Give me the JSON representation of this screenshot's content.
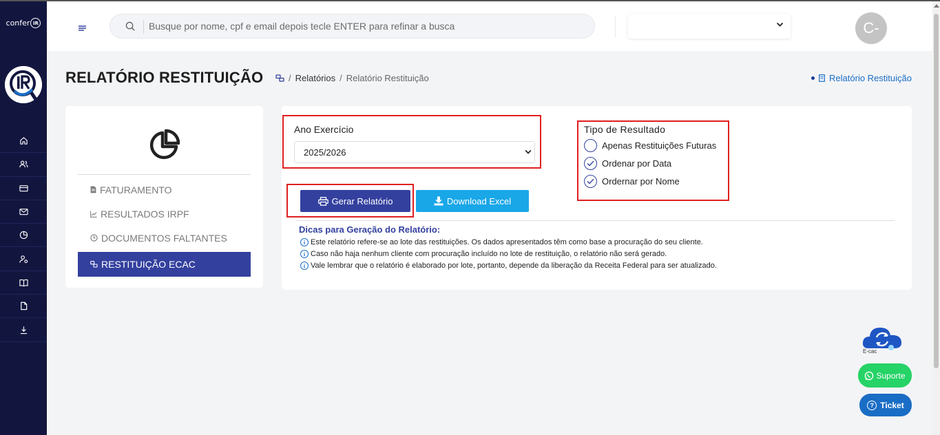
{
  "brand": {
    "logo_text": "confer",
    "logo_mark": "IR"
  },
  "header": {
    "search_placeholder": "Busque por nome, cpf e email depois tecle ENTER para refinar a busca",
    "avatar_initial": "C-"
  },
  "page": {
    "title": "RELATÓRIO RESTITUIÇÃO",
    "breadcrumb": {
      "parent": "Relatórios",
      "current": "Relatório Restituição",
      "separator": "/"
    },
    "top_right_link": "Relatório Restituição"
  },
  "left_menu": {
    "items": [
      {
        "label": "FATURAMENTO",
        "icon": "document-icon"
      },
      {
        "label": "RESULTADOS IRPF",
        "icon": "chart-line-icon"
      },
      {
        "label": "DOCUMENTOS FALTANTES",
        "icon": "clock-icon"
      },
      {
        "label": "RESTITUIÇÃO ECAC",
        "icon": "links-icon",
        "active": true
      }
    ]
  },
  "form": {
    "ano_label": "Ano Exercício",
    "ano_value": "2025/2026",
    "tipo_label": "Tipo de Resultado",
    "radio_options": [
      {
        "label": "Apenas Restituições Futuras",
        "checked": false
      },
      {
        "label": "Ordenar por Data",
        "checked": true
      },
      {
        "label": "Ordernar por Nome",
        "checked": true
      }
    ],
    "gerar_button": "Gerar Relatório",
    "excel_button": "Download Excel"
  },
  "tips": {
    "title": "Dicas para Geração do Relatório:",
    "items": [
      "Este relatório refere-se ao lote das restituições. Os dados apresentados têm como base a procuração do seu cliente.",
      "Caso não haja nenhum cliente com procuração incluído no lote de restituição, o relatório não será gerado.",
      "Vale lembrar que o relatório é elaborado por lote, portanto, depende da liberação da Receita Federal para ser atualizado."
    ]
  },
  "widgets": {
    "ecac_label": "E-cac",
    "suporte_label": "Suporte",
    "ticket_label": "Ticket"
  },
  "colors": {
    "sidebar_bg": "#12163f",
    "primary": "#33409e",
    "excel_button": "#19a7e8",
    "highlight_box": "#e01f1f",
    "whatsapp": "#25d366",
    "ticket": "#1a6dc5"
  }
}
